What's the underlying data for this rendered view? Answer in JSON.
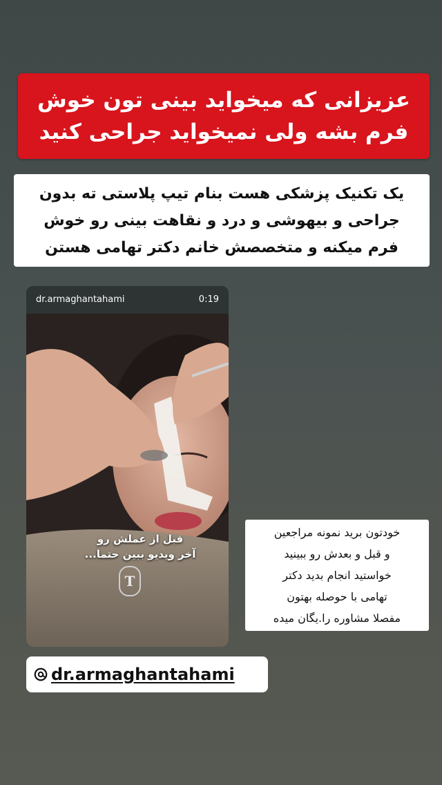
{
  "banner": {
    "text": "عزیزانی که میخواید بینی تون خوش\nفرم بشه ولی نمیخواید جراحی کنید"
  },
  "description": {
    "text": "یک تکنیک پزشکی هست بنام تیپ پلاستی ته بدون\nجراحی و بیهوشی و درد و  نقاهت بینی رو خوش\nفرم میکنه و متخصصش  خانم دکتر تهامی هستن"
  },
  "video": {
    "username": "dr.armaghantahami",
    "duration": "0:19",
    "caption": "قبل از عملش رو\nآخر ویدیو ببین حتما...",
    "logo_letter": "T"
  },
  "note": {
    "text": "خودتون برید نمونه مراجعین\nو قبل و بعدش      رو ببینید\nخواستید انجام    بدید دکتر\nتهامی با  حوصله     بهتون\nمفصلا مشاوره را.یگان میده"
  },
  "mention": {
    "icon": "threads-icon",
    "handle": "dr.armaghantahami"
  }
}
